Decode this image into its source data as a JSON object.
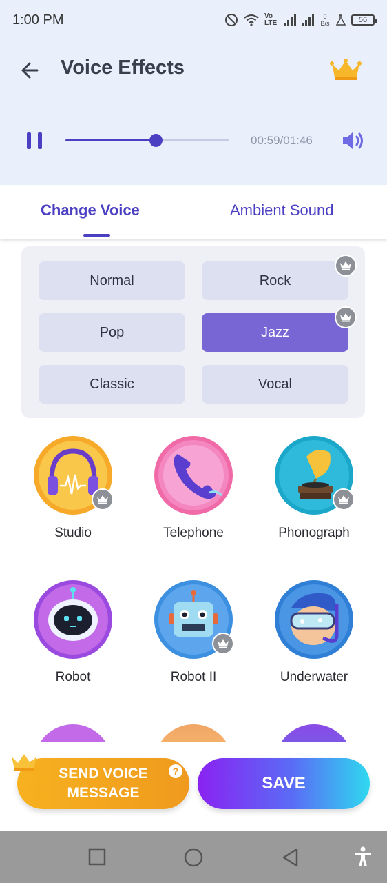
{
  "status_bar": {
    "time": "1:00 PM",
    "network": "Vo LTE",
    "data_rate": "0 B/s",
    "battery": "56"
  },
  "header": {
    "title": "Voice Effects"
  },
  "player": {
    "current_time": "00:59",
    "total_time": "01:46",
    "timecode": "00:59/01:46",
    "progress": 0.55
  },
  "tabs": [
    {
      "label": "Change Voice",
      "active": true
    },
    {
      "label": "Ambient Sound",
      "active": false
    }
  ],
  "genres": [
    {
      "label": "Normal",
      "selected": false,
      "premium": false
    },
    {
      "label": "Rock",
      "selected": false,
      "premium": true
    },
    {
      "label": "Pop",
      "selected": false,
      "premium": false
    },
    {
      "label": "Jazz",
      "selected": true,
      "premium": true
    },
    {
      "label": "Classic",
      "selected": false,
      "premium": false
    },
    {
      "label": "Vocal",
      "selected": false,
      "premium": false
    }
  ],
  "effects": [
    {
      "label": "Studio",
      "icon": "headphones-icon",
      "premium": true
    },
    {
      "label": "Telephone",
      "icon": "telephone-icon",
      "premium": false
    },
    {
      "label": "Phonograph",
      "icon": "phonograph-icon",
      "premium": true
    },
    {
      "label": "Robot",
      "icon": "robot-icon",
      "premium": false
    },
    {
      "label": "Robot II",
      "icon": "robot-ii-icon",
      "premium": true
    },
    {
      "label": "Underwater",
      "icon": "diver-icon",
      "premium": false
    }
  ],
  "buttons": {
    "send_line1": "SEND VOICE",
    "send_line2": "MESSAGE",
    "help": "?",
    "save": "SAVE"
  },
  "colors": {
    "accent": "#4b3fc2",
    "selected_genre": "#7866d4",
    "send": "#f4a71f",
    "save_start": "#8a22f2",
    "save_end": "#2fd8ef"
  }
}
